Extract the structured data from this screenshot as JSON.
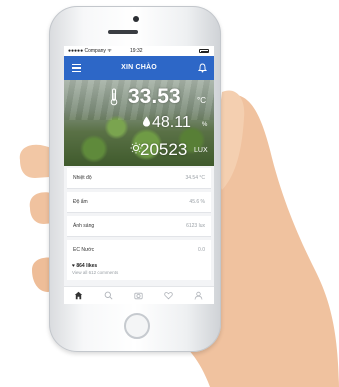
{
  "status_bar": {
    "carrier": "●●●●● Company ᯤ",
    "time": "19:32"
  },
  "app_bar": {
    "title": "XIN CHÀO",
    "menu_icon": "menu-icon",
    "bell_icon": "bell-icon"
  },
  "hero": {
    "temperature": {
      "value": "33.53",
      "unit": "°C",
      "icon": "thermometer-icon"
    },
    "humidity": {
      "value": "48.11",
      "unit": "%",
      "icon": "water-drop-icon"
    },
    "light": {
      "value": "20523",
      "unit": "LUX",
      "icon": "sun-icon"
    }
  },
  "sensors": [
    {
      "label": "Nhiệt độ",
      "value": "34.54 °C"
    },
    {
      "label": "Độ ẩm",
      "value": "45.6 %"
    },
    {
      "label": "Ánh sáng",
      "value": "6123 lux"
    },
    {
      "label": "EC Nước",
      "value": "0.0"
    }
  ],
  "feed": {
    "likes": "♥ 864 likes",
    "comments": "View all 612 comments"
  },
  "tabs": [
    "home-icon",
    "search-icon",
    "camera-icon",
    "heart-icon",
    "profile-icon"
  ],
  "colors": {
    "appbar": "#2d67c7",
    "skin": "#f1c7a6",
    "phone_frame": "#f4f5f7"
  }
}
